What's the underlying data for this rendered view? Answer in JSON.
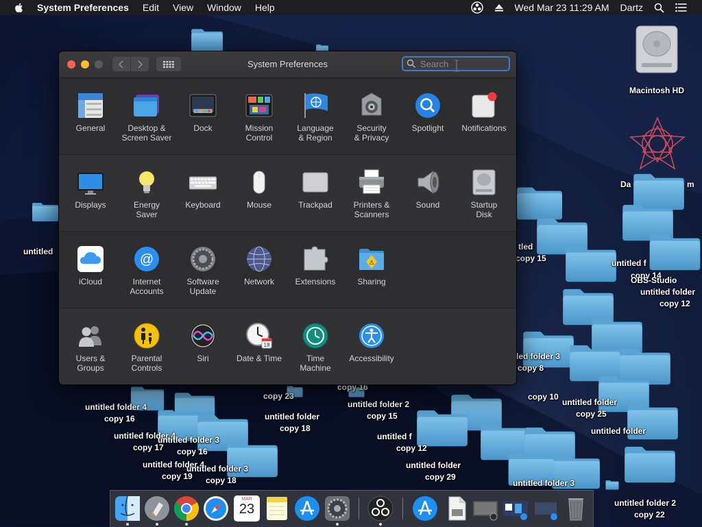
{
  "menubar": {
    "app_name": "System Preferences",
    "menus": [
      "Edit",
      "View",
      "Window",
      "Help"
    ],
    "clock": "Wed Mar 23  11:29 AM",
    "user": "Dartz"
  },
  "window": {
    "title": "System Preferences",
    "search_placeholder": "Search",
    "rows": [
      [
        {
          "id": "general",
          "label": "General",
          "icon": "general-icon"
        },
        {
          "id": "desktop",
          "label": "Desktop &\nScreen Saver",
          "icon": "desktop-screensaver-icon"
        },
        {
          "id": "dock",
          "label": "Dock",
          "icon": "dock-icon"
        },
        {
          "id": "mission",
          "label": "Mission\nControl",
          "icon": "mission-control-icon"
        },
        {
          "id": "language",
          "label": "Language\n& Region",
          "icon": "language-region-icon"
        },
        {
          "id": "security",
          "label": "Security\n& Privacy",
          "icon": "security-privacy-icon"
        },
        {
          "id": "spotlight",
          "label": "Spotlight",
          "icon": "spotlight-icon"
        },
        {
          "id": "notifications",
          "label": "Notifications",
          "icon": "notifications-icon"
        }
      ],
      [
        {
          "id": "displays",
          "label": "Displays",
          "icon": "displays-icon"
        },
        {
          "id": "energy",
          "label": "Energy\nSaver",
          "icon": "energy-saver-icon"
        },
        {
          "id": "keyboard",
          "label": "Keyboard",
          "icon": "keyboard-icon"
        },
        {
          "id": "mouse",
          "label": "Mouse",
          "icon": "mouse-icon"
        },
        {
          "id": "trackpad",
          "label": "Trackpad",
          "icon": "trackpad-icon"
        },
        {
          "id": "printers",
          "label": "Printers &\nScanners",
          "icon": "printers-scanners-icon"
        },
        {
          "id": "sound",
          "label": "Sound",
          "icon": "sound-icon"
        },
        {
          "id": "startup",
          "label": "Startup\nDisk",
          "icon": "startup-disk-icon"
        }
      ],
      [
        {
          "id": "icloud",
          "label": "iCloud",
          "icon": "icloud-icon"
        },
        {
          "id": "internet",
          "label": "Internet\nAccounts",
          "icon": "internet-accounts-icon"
        },
        {
          "id": "software",
          "label": "Software\nUpdate",
          "icon": "software-update-icon"
        },
        {
          "id": "network",
          "label": "Network",
          "icon": "network-icon"
        },
        {
          "id": "extensions",
          "label": "Extensions",
          "icon": "extensions-icon"
        },
        {
          "id": "sharing",
          "label": "Sharing",
          "icon": "sharing-icon"
        }
      ],
      [
        {
          "id": "users",
          "label": "Users &\nGroups",
          "icon": "users-groups-icon"
        },
        {
          "id": "parental",
          "label": "Parental\nControls",
          "icon": "parental-controls-icon"
        },
        {
          "id": "siri",
          "label": "Siri",
          "icon": "siri-icon"
        },
        {
          "id": "datetime",
          "label": "Date & Time",
          "icon": "date-time-icon"
        },
        {
          "id": "timemachine",
          "label": "Time\nMachine",
          "icon": "time-machine-icon"
        },
        {
          "id": "accessibility",
          "label": "Accessibility",
          "icon": "accessibility-icon"
        }
      ]
    ]
  },
  "desktop": {
    "drive_label": "Macintosh HD",
    "right_labels": [
      {
        "text": "Da",
        "extra": "m"
      },
      {
        "text": "untitled f",
        "id": "l1"
      },
      {
        "text": "copy 14"
      },
      {
        "text": "OBS-Studio"
      },
      {
        "text": "untitled folder"
      },
      {
        "text": "copy 12"
      },
      {
        "text": "copy 15"
      },
      {
        "text": "tled"
      },
      {
        "text": "untitled folder 3"
      },
      {
        "text": "copy 8"
      },
      {
        "text": "copy 10"
      },
      {
        "text": "untitled folder"
      },
      {
        "text": "copy 25"
      },
      {
        "text": "untitled folder"
      },
      {
        "text": "untitled folder 2"
      },
      {
        "text": "copy 22"
      },
      {
        "text": "untitled folder 3"
      }
    ],
    "left_labels": [
      {
        "text": "untitled"
      },
      {
        "text": "untitled folder 4"
      },
      {
        "text": "copy 16"
      },
      {
        "text": "untitled folder 4"
      },
      {
        "text": "copy 17"
      },
      {
        "text": "untitled folder 3"
      },
      {
        "text": "copy 16"
      },
      {
        "text": "untitled folder 4"
      },
      {
        "text": "copy 19"
      },
      {
        "text": "untitled folder 3"
      },
      {
        "text": "copy 18"
      },
      {
        "text": "copy 23"
      },
      {
        "text": "untitled folder"
      },
      {
        "text": "copy 18"
      },
      {
        "text": "untitled folder 2"
      },
      {
        "text": "copy 15"
      },
      {
        "text": "untitled f"
      },
      {
        "text": "copy 12"
      },
      {
        "text": "untitled folder"
      },
      {
        "text": "copy 29"
      },
      {
        "text": "copy 16"
      }
    ]
  },
  "dock": {
    "calendar_month": "MAR",
    "calendar_day": "23"
  }
}
